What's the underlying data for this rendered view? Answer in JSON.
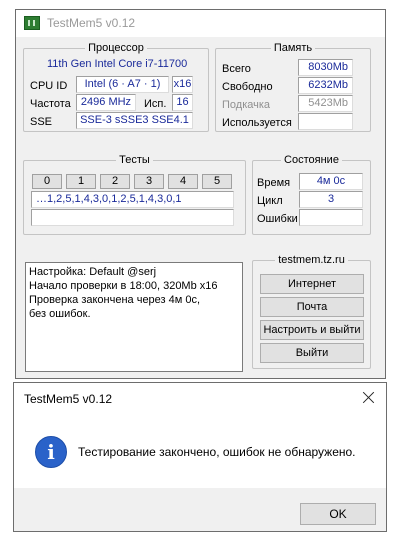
{
  "main_window": {
    "title": "TestMem5 v0.12",
    "cpu": {
      "heading": "Процессор",
      "name": "11th Gen Intel Core i7-11700",
      "id_label": "CPU ID",
      "id_value": "Intel (6 · A7 · 1)",
      "id_threads": "x16",
      "freq_label": "Частота",
      "freq_value": "2496 MHz",
      "used_label": "Исп.",
      "used_value": "16",
      "sse_label": "SSE",
      "sse_value": "SSE-3 sSSE3 SSE4.1"
    },
    "memory": {
      "heading": "Память",
      "total_label": "Всего",
      "total_value": "8030Mb",
      "free_label": "Свободно",
      "free_value": "6232Mb",
      "swap_label": "Подкачка",
      "swap_value": "5423Mb",
      "used_label": "Используется",
      "used_value": ""
    },
    "tests": {
      "heading": "Тесты",
      "numbers": [
        "0",
        "1",
        "2",
        "3",
        "4",
        "5"
      ],
      "sequence": "…1,2,5,1,4,3,0,1,2,5,1,4,3,0,1",
      "extra": ""
    },
    "status": {
      "heading": "Состояние",
      "time_label": "Время",
      "time_value": "4м 0с",
      "cycle_label": "Цикл",
      "cycle_value": "3",
      "errors_label": "Ошибки",
      "errors_value": ""
    },
    "log_lines": [
      "Настройка: Default @serj",
      "Начало проверки в 18:00, 320Mb x16",
      "Проверка закончена через 4м 0с,",
      "без ошибок."
    ],
    "links": {
      "site": "testmem.tz.ru",
      "internet": "Интернет",
      "mail": "Почта",
      "configure_exit": "Настроить и выйти",
      "exit": "Выйти"
    }
  },
  "dialog": {
    "title": "TestMem5 v0.12",
    "message": "Тестирование закончено, ошибок не обнаружено.",
    "ok": "OK"
  },
  "colors": {
    "window_bg": "#f0f0f0",
    "value_blue": "#1a2a9a",
    "info_blue": "#2a62c9"
  },
  "icons": [
    "app-icon",
    "info-icon",
    "close-icon"
  ]
}
